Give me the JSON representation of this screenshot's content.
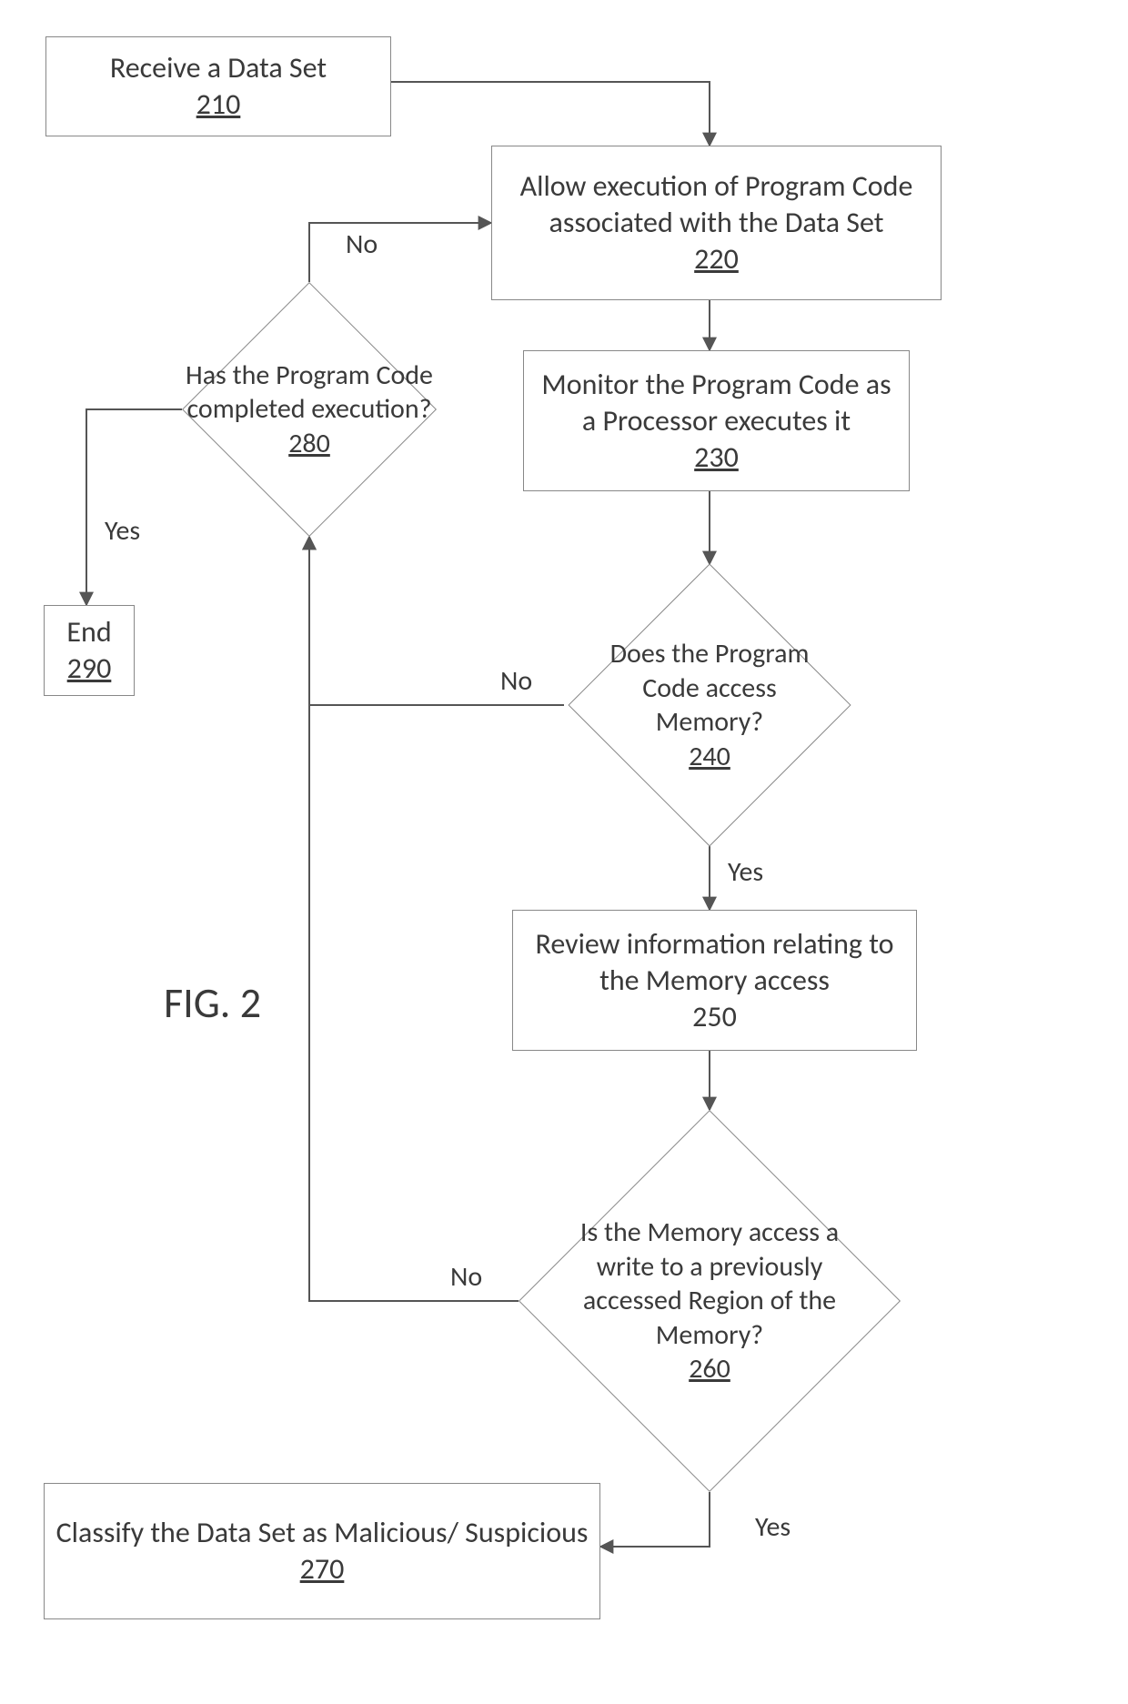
{
  "figure_label": "FIG. 2",
  "nodes": {
    "n210": {
      "text": "Receive a Data Set",
      "num": "210"
    },
    "n220": {
      "text": "Allow execution of Program Code associated with the Data Set",
      "num": "220"
    },
    "n230": {
      "text": "Monitor the Program Code as a Processor executes it",
      "num": "230"
    },
    "n240": {
      "text": "Does the Program Code access Memory?",
      "num": "240"
    },
    "n250": {
      "text": "Review information relating to the Memory access",
      "num": "250"
    },
    "n260": {
      "text": "Is the Memory access a write to a previously accessed Region of the Memory?",
      "num": "260"
    },
    "n270": {
      "text": "Classify the Data Set as Malicious/ Suspicious",
      "num": "270"
    },
    "n280": {
      "text": "Has the Program Code completed execution?",
      "num": "280"
    },
    "n290": {
      "text": "End",
      "num": "290"
    }
  },
  "edge_labels": {
    "e240_no": "No",
    "e240_yes": "Yes",
    "e260_no": "No",
    "e260_yes": "Yes",
    "e280_no": "No",
    "e280_yes": "Yes"
  }
}
